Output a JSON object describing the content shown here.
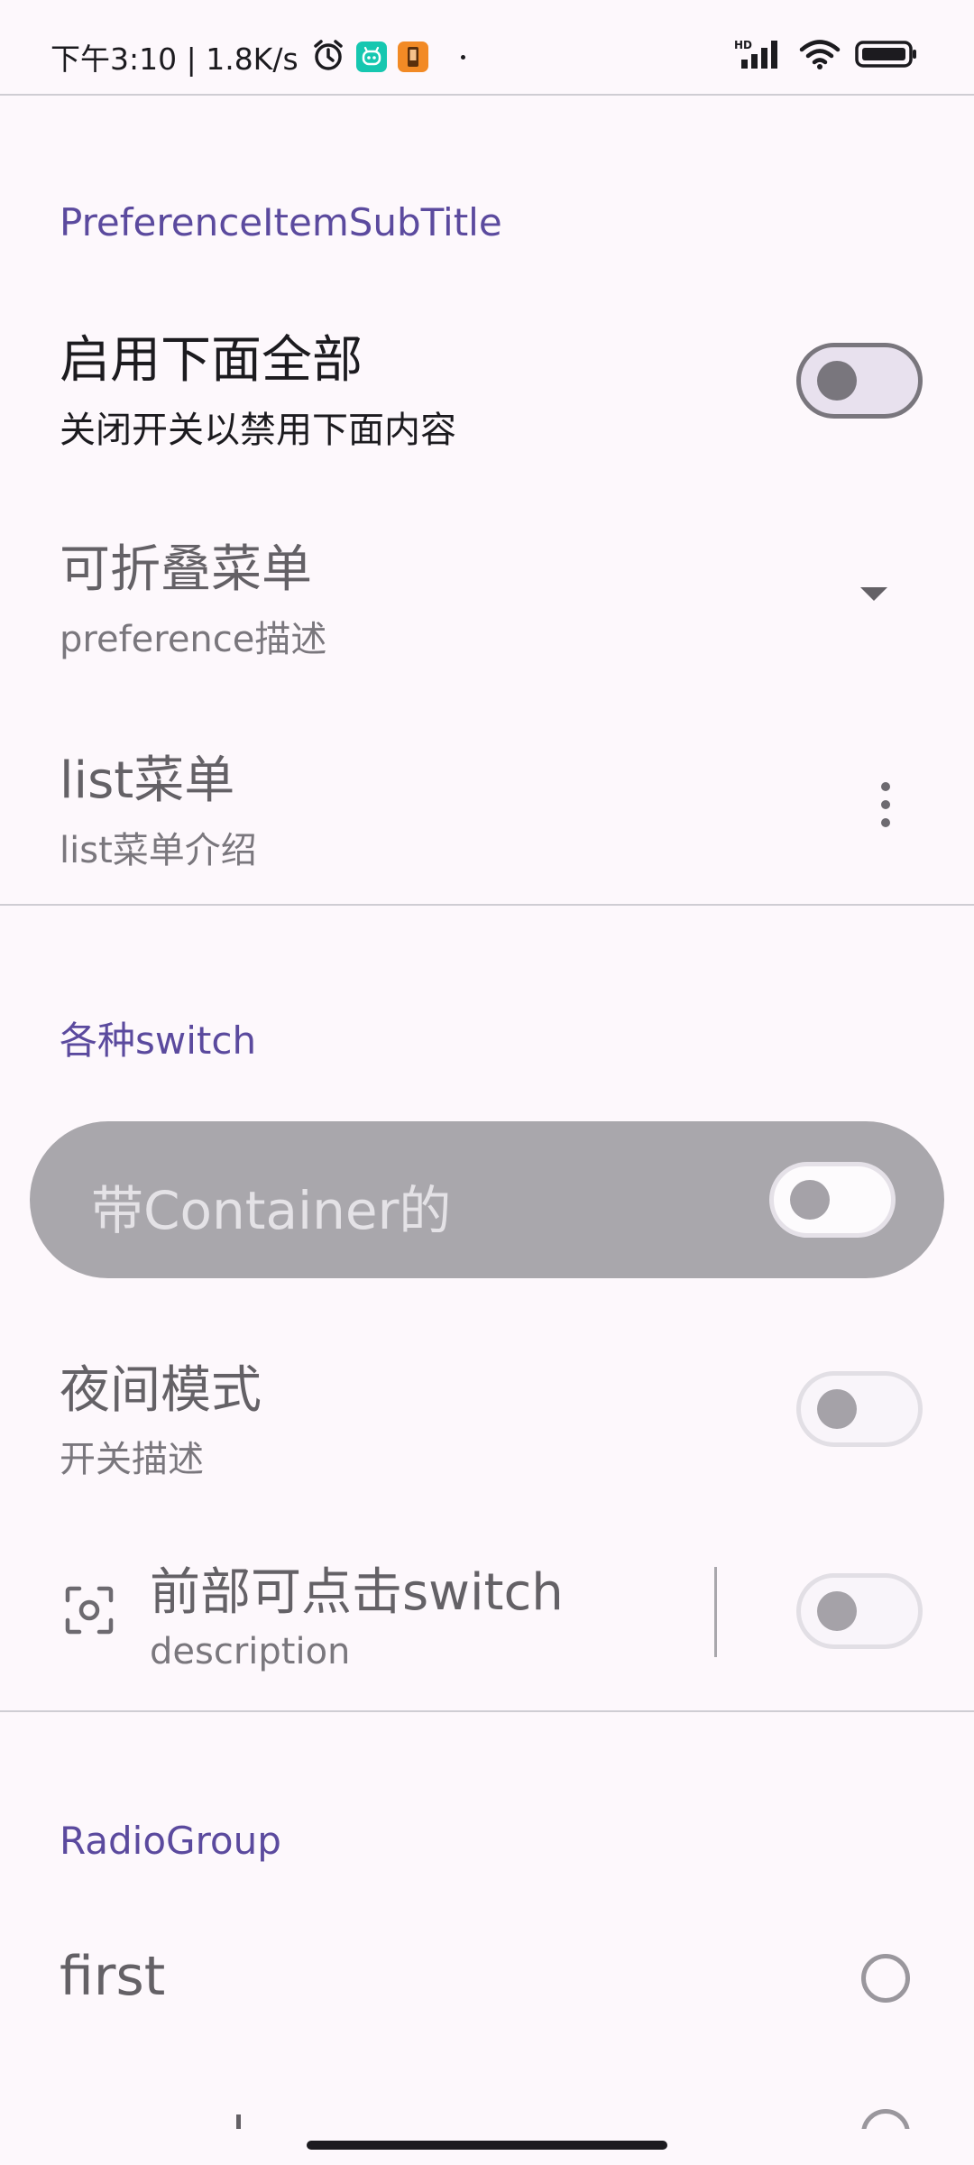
{
  "status_bar": {
    "time_speed": "下午3:10 | 1.8K/s",
    "network_label": "HD"
  },
  "section1": {
    "header": "PreferenceItemSubTitle",
    "enable_all": {
      "title": "启用下面全部",
      "subtitle": "关闭开关以禁用下面内容",
      "switch_on": false
    },
    "collapsible": {
      "title": "可折叠菜单",
      "subtitle": "preference描述"
    },
    "list_menu": {
      "title": "list菜单",
      "subtitle": "list菜单介绍"
    }
  },
  "section2": {
    "header": "各种switch",
    "container_switch": {
      "label": "带Container的",
      "switch_on": false
    },
    "night_mode": {
      "title": "夜间模式",
      "subtitle": "开关描述",
      "switch_on": false
    },
    "front_clickable": {
      "title": "前部可点击switch",
      "subtitle": "description",
      "switch_on": false
    }
  },
  "section3": {
    "header": "RadioGroup",
    "options": [
      {
        "label": "first",
        "selected": false
      }
    ]
  },
  "colors": {
    "accent": "#5b4a9e",
    "background": "#fdf8fc",
    "container": "#a9a7ac"
  }
}
